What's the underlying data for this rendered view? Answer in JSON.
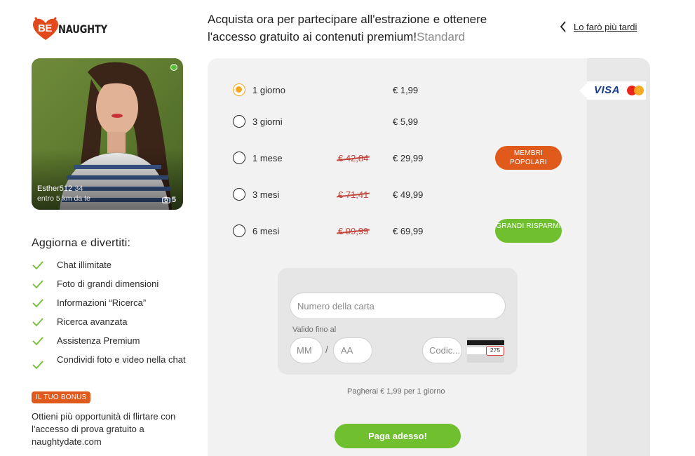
{
  "brand": {
    "prefix": "BE",
    "name": "NAUGHTY",
    "accent": "#e24a1e"
  },
  "header": {
    "headline": "Acquista ora per partecipare all'estrazione e ottenere l'accesso gratuito ai contenuti premium!",
    "plan_type": "Standard",
    "later_label": "Lo farò più tardi"
  },
  "profile": {
    "name": "Esther512",
    "age": "34",
    "distance": "entro 5 km da te",
    "photo_count": "5",
    "online": true
  },
  "features": {
    "title": "Aggiorna e divertiti:",
    "items": [
      "Chat illimitate",
      "Foto di grandi dimensioni",
      "Informazioni “Ricerca”",
      "Ricerca avanzata",
      "Assistenza Premium",
      "Condividi foto e video nella chat"
    ]
  },
  "bonus": {
    "badge": "IL TUO BONUS",
    "text": "Ottieni più opportunità di flirtare con l'accesso di prova gratuito a naughtydate.com"
  },
  "plans": [
    {
      "label": "1 giorno",
      "old_price": "",
      "price": "€ 1,99",
      "badge": "",
      "selected": true
    },
    {
      "label": "3 giorni",
      "old_price": "",
      "price": "€ 5,99",
      "badge": "",
      "selected": false
    },
    {
      "label": "1 mese",
      "old_price": "€ 42,84",
      "price": "€ 29,99",
      "badge": "MEMBRI POPOLARI",
      "badge_color": "orange",
      "selected": false
    },
    {
      "label": "3 mesi",
      "old_price": "€ 71,41",
      "price": "€ 49,99",
      "badge": "",
      "selected": false
    },
    {
      "label": "6 mesi",
      "old_price": "€ 99,99",
      "price": "€ 69,99",
      "badge": "GRANDI RISPARMI",
      "badge_color": "green",
      "selected": false
    }
  ],
  "payment_methods": {
    "visa_label": "VISA",
    "mastercard": "mastercard-icon"
  },
  "form": {
    "card_placeholder": "Numero della carta",
    "valid_label": "Valido fino al",
    "mm_placeholder": "MM",
    "slash": "/",
    "aa_placeholder": "AA",
    "cvv_placeholder": "Codic...",
    "cvv_example": "275"
  },
  "summary": "Pagherai € 1,99 per 1 giorno",
  "pay_button": "Paga adesso!",
  "colors": {
    "orange": "#e05a1c",
    "green": "#6fbf2f",
    "radio_selected": "#f5a623",
    "strike": "#c2463d"
  }
}
